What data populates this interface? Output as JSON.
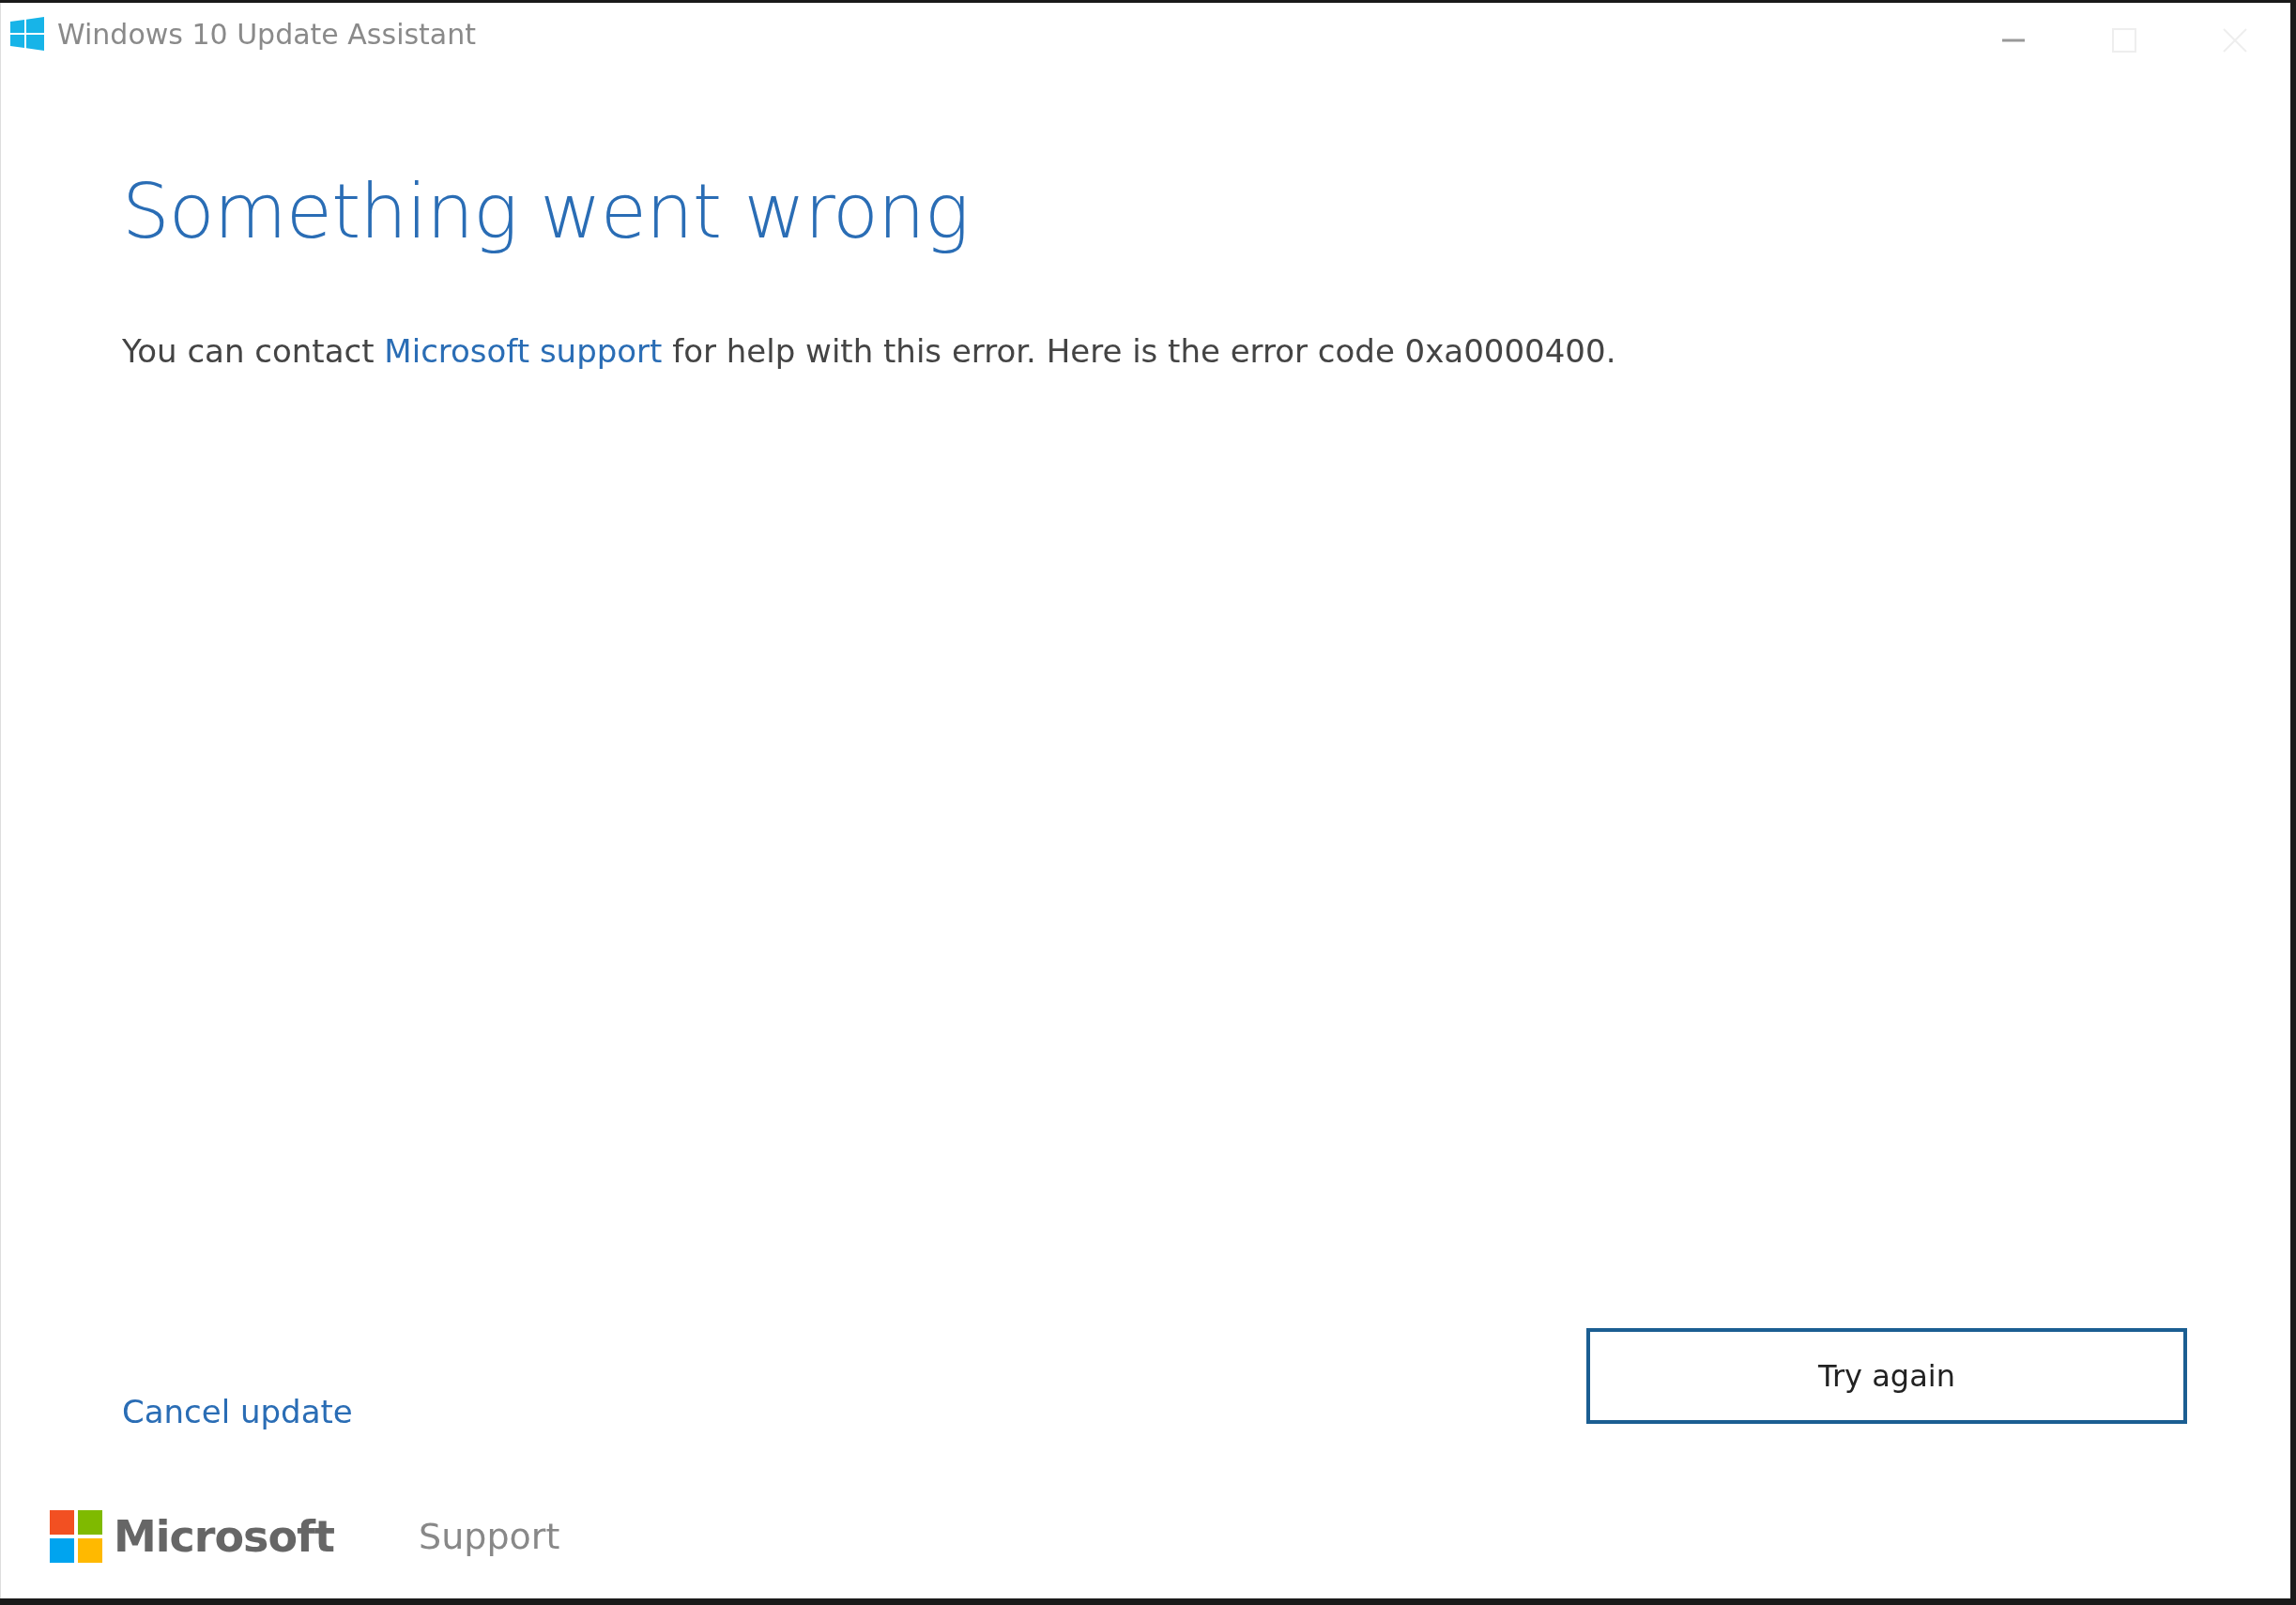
{
  "window": {
    "title": "Windows 10 Update Assistant"
  },
  "heading": "Something went wrong",
  "message": {
    "before": "You can contact ",
    "link": "Microsoft support",
    "after": " for help with this error. Here is the error code 0xa0000400."
  },
  "cancel_link": "Cancel update",
  "primary_button": "Try again",
  "footer": {
    "brand": "Microsoft",
    "support_link": "Support"
  }
}
